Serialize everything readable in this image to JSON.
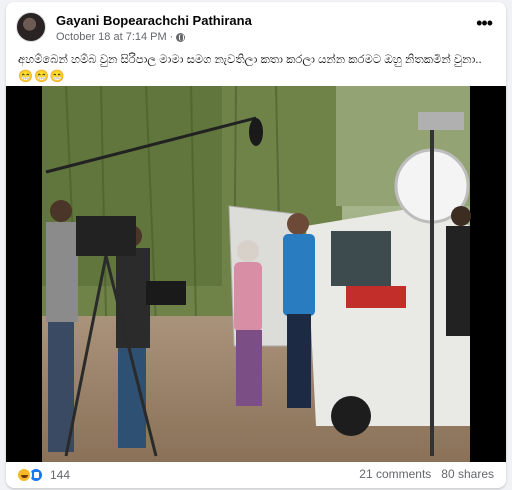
{
  "post": {
    "author": "Gayani Bopearachchi Pathirana",
    "date": "October 18 at 7:14 PM",
    "separator": "·",
    "visibility_icon": "globe-icon",
    "menu_icon": "more-options-icon",
    "caption": "අහම්බෙන් හම්බ වුන සිරිපාල මාමා සමග නැවතිලා කතා කරලා යන්න කරමට ඔහු නිතකමින් වුනා..",
    "caption_emojis": "😁😁😁"
  },
  "reactions": {
    "icons": [
      "haha-reaction-icon",
      "like-reaction-icon"
    ],
    "count": "144",
    "comments": "21 comments",
    "shares": "80 shares"
  },
  "colors": {
    "link_blue": "#1877f2",
    "meta_gray": "#65676b"
  }
}
